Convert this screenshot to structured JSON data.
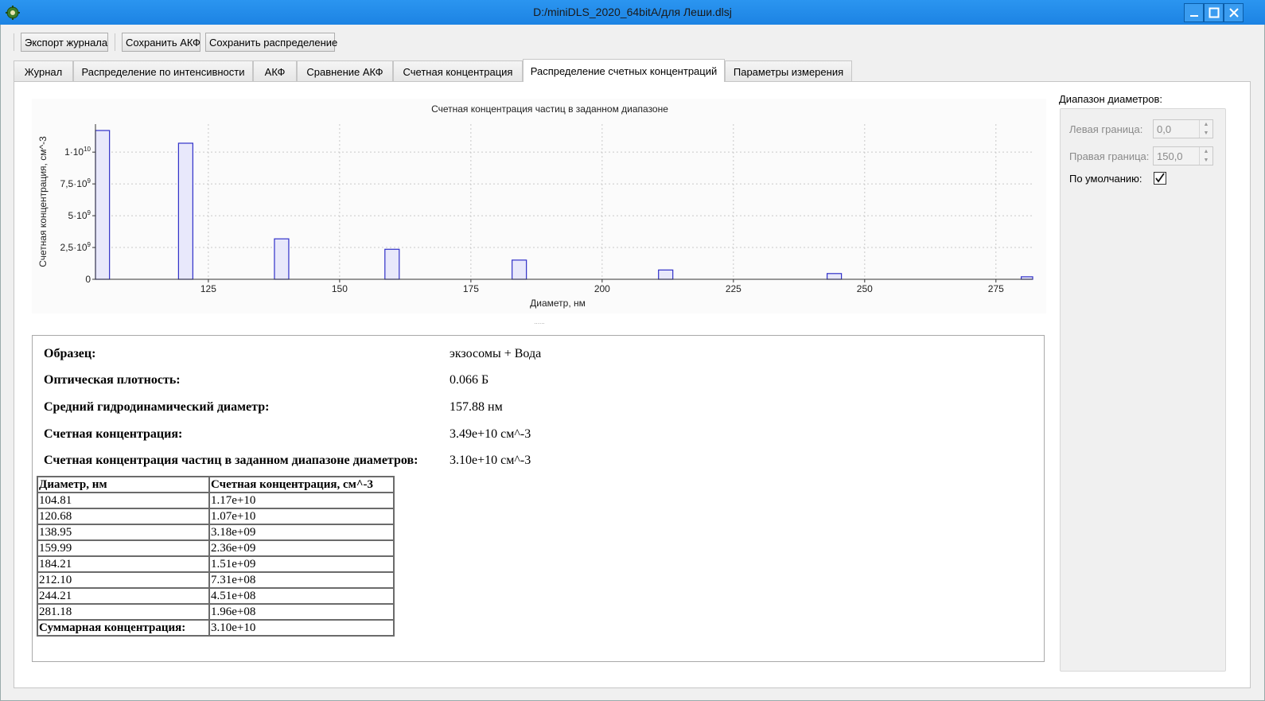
{
  "window": {
    "title": "D:/miniDLS_2020_64bitA/для Леши.dlsj",
    "icon": "gear-icon",
    "controls": [
      "minimize-icon",
      "maximize-icon",
      "close-icon"
    ]
  },
  "toolbar": {
    "export_journal": "Экспорт журнала",
    "save_acf": "Сохранить АКФ",
    "save_distribution": "Сохранить распределение"
  },
  "tabs": [
    {
      "label": "Журнал"
    },
    {
      "label": "Распределение по интенсивности"
    },
    {
      "label": "АКФ"
    },
    {
      "label": "Сравнение АКФ"
    },
    {
      "label": "Счетная концентрация"
    },
    {
      "label": "Распределение счетных концентраций",
      "active": true
    },
    {
      "label": "Параметры измерения"
    }
  ],
  "chart_data": {
    "type": "bar",
    "title": "Счетная концентрация частиц в заданном диапазоне",
    "xlabel": "Диаметр, нм",
    "ylabel": "Счетная концентрация, см^-3",
    "x": [
      104.81,
      120.68,
      138.95,
      159.99,
      184.21,
      212.1,
      244.21,
      281.18
    ],
    "values": [
      11700000000.0,
      10700000000.0,
      3180000000.0,
      2360000000.0,
      1510000000.0,
      731000000.0,
      451000000.0,
      196000000.0
    ],
    "xlim": [
      103.5,
      282
    ],
    "ylim": [
      0,
      11700000000.0
    ],
    "x_ticks": [
      "125",
      "150",
      "175",
      "200",
      "225",
      "250",
      "275"
    ],
    "x_tick_values": [
      125,
      150,
      175,
      200,
      225,
      250,
      275
    ],
    "y_ticks": [
      "0",
      "2,5·10",
      "5·10",
      "7,5·10",
      "1·10"
    ],
    "y_tick_exponents": [
      "",
      "9",
      "9",
      "9",
      "10"
    ],
    "y_tick_values": [
      0,
      2500000000.0,
      5000000000.0,
      7500000000.0,
      10000000000.0
    ],
    "grid": true,
    "bar_fill": "#e8e8fb",
    "bar_stroke": "#3030c8"
  },
  "info": {
    "sample_label": "Образец:",
    "sample_value": "экзосомы + Вода",
    "od_label": "Оптическая плотность:",
    "od_value": "0.066 Б",
    "mean_diam_label": "Средний гидродинамический диаметр:",
    "mean_diam_value": "157.88 нм",
    "count_conc_label": "Счетная концентрация:",
    "count_conc_value": "3.49e+10 см^-3",
    "range_conc_label": "Счетная концентрация частиц в заданном диапазоне диаметров:",
    "range_conc_value": "3.10e+10 см^-3"
  },
  "table": {
    "headers": [
      "Диаметр, нм",
      "Счетная концентрация, см^-3"
    ],
    "rows": [
      [
        "104.81",
        "1.17e+10"
      ],
      [
        "120.68",
        "1.07e+10"
      ],
      [
        "138.95",
        "3.18e+09"
      ],
      [
        "159.99",
        "2.36e+09"
      ],
      [
        "184.21",
        "1.51e+09"
      ],
      [
        "212.10",
        "7.31e+08"
      ],
      [
        "244.21",
        "4.51e+08"
      ],
      [
        "281.18",
        "1.96e+08"
      ]
    ],
    "total_label": "Суммарная концентрация:",
    "total_value": "3.10e+10"
  },
  "range_panel": {
    "title": "Диапазон диаметров:",
    "left_label": "Левая граница:",
    "left_value": "0,0",
    "right_label": "Правая граница:",
    "right_value": "150,0",
    "default_label": "По умолчанию:",
    "default_checked": true
  }
}
